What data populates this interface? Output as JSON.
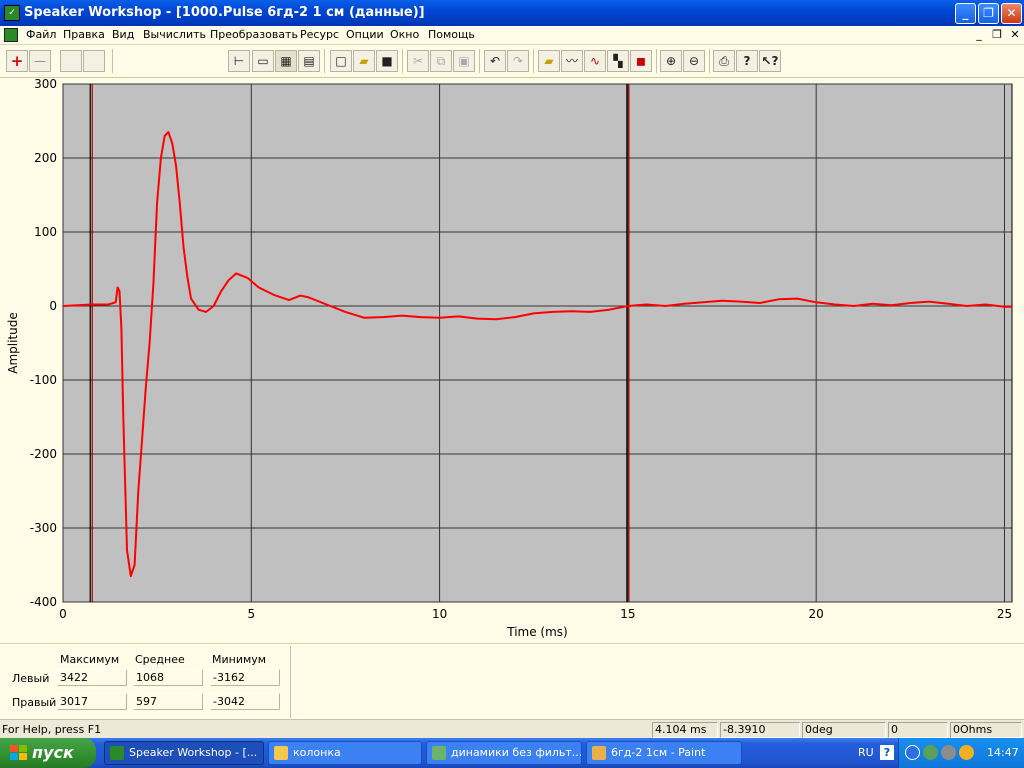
{
  "window": {
    "title": "Speaker Workshop - [1000.Pulse 6гд-2 1 см (данные)]",
    "minimize": "_",
    "restore": "❐",
    "close": "✕"
  },
  "menu": {
    "items": [
      "Файл",
      "Правка",
      "Вид",
      "Вычислить",
      "Преобразовать",
      "Ресурс",
      "Опции",
      "Окно",
      "Помощь"
    ]
  },
  "mdi": {
    "minimize": "_",
    "restore": "❐",
    "close": "✕"
  },
  "toolbar": {
    "plus": "+",
    "minus": "—"
  },
  "chart_data": {
    "type": "line",
    "title": "",
    "xlabel": "Time (ms)",
    "ylabel": "Amplitude",
    "xlim": [
      0,
      25.2
    ],
    "ylim": [
      -400,
      300
    ],
    "xticks": [
      0,
      5,
      10,
      15,
      20,
      25
    ],
    "yticks": [
      300,
      200,
      100,
      0,
      -100,
      -200,
      -300,
      -400
    ],
    "grid": true,
    "background": "#c0c0c0",
    "line_color": "#ff0000",
    "markers": [
      0.75,
      15
    ],
    "series": [
      {
        "x": [
          0,
          0.4,
          0.75,
          1.2,
          1.4,
          1.45,
          1.5,
          1.55,
          1.6,
          1.7,
          1.8,
          1.9,
          2.0,
          2.1,
          2.2,
          2.3,
          2.4,
          2.5,
          2.6,
          2.7,
          2.8,
          2.9,
          3.0,
          3.1,
          3.2,
          3.3,
          3.4,
          3.6,
          3.8,
          4.0,
          4.2,
          4.4,
          4.6,
          4.9,
          5.2,
          5.6,
          6.0,
          6.3,
          6.5,
          7.0,
          7.5,
          8.0,
          8.5,
          9.0,
          9.5,
          10.0,
          10.5,
          11.0,
          11.5,
          12.0,
          12.5,
          13.0,
          13.5,
          14.0,
          14.5,
          15.0,
          15.5,
          16.0,
          16.5,
          17.0,
          17.5,
          18.0,
          18.5,
          19.0,
          19.5,
          20.0,
          20.5,
          21.0,
          21.5,
          22.0,
          22.5,
          23.0,
          23.5,
          24.0,
          24.5,
          25.0,
          25.2
        ],
        "y": [
          0,
          1,
          2,
          2,
          5,
          25,
          20,
          -30,
          -150,
          -330,
          -365,
          -350,
          -250,
          -180,
          -110,
          -50,
          30,
          140,
          200,
          230,
          235,
          220,
          190,
          140,
          80,
          40,
          10,
          -5,
          -8,
          0,
          20,
          35,
          44,
          38,
          25,
          15,
          8,
          14,
          12,
          2,
          -8,
          -16,
          -15,
          -13,
          -15,
          -16,
          -14,
          -17,
          -18,
          -15,
          -10,
          -8,
          -7,
          -8,
          -5,
          0,
          2,
          0,
          3,
          5,
          7,
          6,
          4,
          9,
          10,
          5,
          2,
          0,
          3,
          1,
          4,
          6,
          3,
          0,
          2,
          -1,
          -1
        ]
      }
    ]
  },
  "stats": {
    "col_max": "Максимум",
    "col_avg": "Среднее",
    "col_min": "Минимум",
    "row_left": "Левый",
    "row_right": "Правый",
    "left": {
      "max": "3422",
      "avg": "1068",
      "min": "-3162"
    },
    "right": {
      "max": "3017",
      "avg": "597",
      "min": "-3042"
    }
  },
  "statusbar": {
    "help": "For Help, press F1",
    "time": "4.104  ms",
    "value": "-8.3910",
    "phase": "0deg",
    "zero": "0",
    "ohms": "0Ohms"
  },
  "taskbar": {
    "start": "пуск",
    "tasks": [
      "Speaker Workshop - [...",
      "колонка",
      "динамики без фильт...",
      "6гд-2 1см - Paint"
    ],
    "lang": "RU",
    "help": "?",
    "clock": "14:47"
  }
}
